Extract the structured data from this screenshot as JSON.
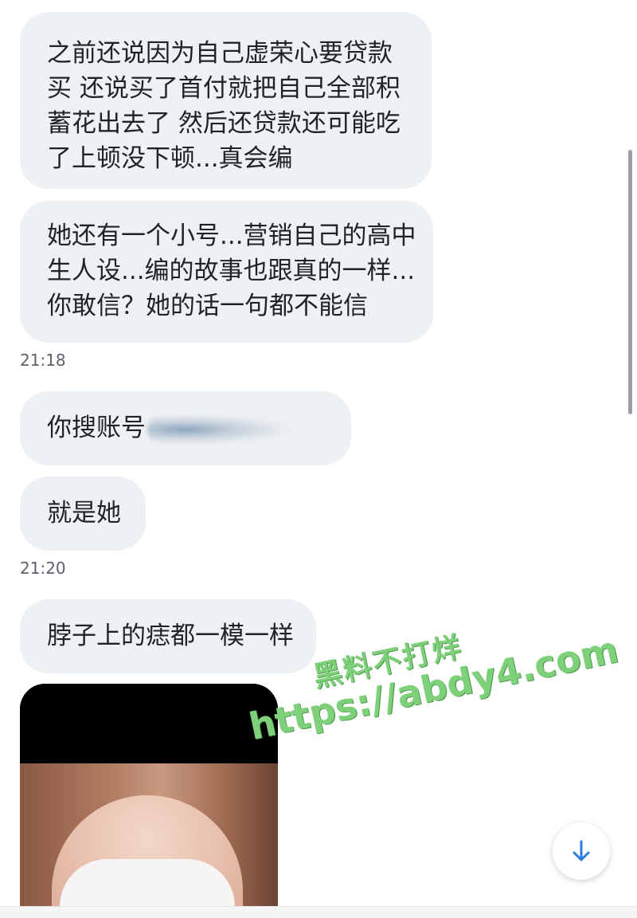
{
  "messages": [
    {
      "lines": [
        "之前还说因为自己虚荣心要贷款",
        "买  还说买了首付就把自己全部积",
        "蓄花出去了   然后还贷款还可能吃",
        "了上顿没下顿...真会编"
      ]
    },
    {
      "lines": [
        "她还有一个小号...营销自己的高中",
        "生人设...编的故事也跟真的一样...",
        "你敢信？她的话一句都不能信"
      ]
    },
    {
      "text": "你搜账号"
    },
    {
      "text": "就是她"
    },
    {
      "text": "脖子上的痣都一模一样"
    }
  ],
  "timestamps": [
    "21:18",
    "21:20"
  ],
  "watermark": {
    "line1": "黑料不打烊",
    "line2": "https://abdy4.com"
  },
  "icons": {
    "scroll_down": "arrow-down-icon"
  },
  "colors": {
    "bubble": "#eef1f3",
    "accent": "#2a7de1",
    "watermark": "#7fd07a"
  }
}
